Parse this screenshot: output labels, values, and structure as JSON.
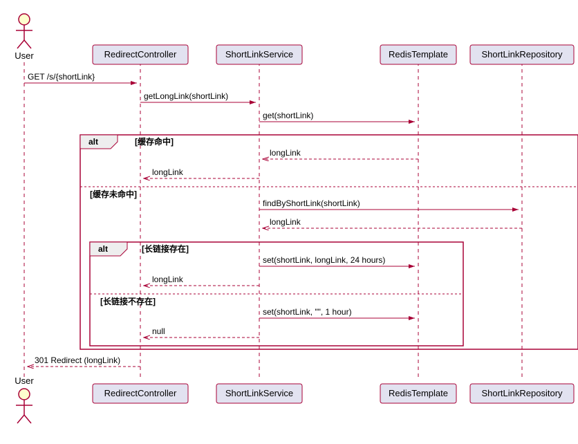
{
  "actor": {
    "name": "User"
  },
  "participants": {
    "p1": "RedirectController",
    "p2": "ShortLinkService",
    "p3": "RedisTemplate",
    "p4": "ShortLinkRepository"
  },
  "messages": {
    "m1": "GET /s/{shortLink}",
    "m2": "getLongLink(shortLink)",
    "m3": "get(shortLink)",
    "m4": "longLink",
    "m5": "longLink",
    "m6": "findByShortLink(shortLink)",
    "m7": "longLink",
    "m8": "set(shortLink, longLink, 24 hours)",
    "m9": "longLink",
    "m10": "set(shortLink, \"\", 1 hour)",
    "m11": "null",
    "m12": "301 Redirect (longLink)"
  },
  "alt": {
    "label": "alt",
    "cond1": "[缓存命中]",
    "cond2": "[缓存未命中]",
    "inner_cond1": "[长链接存在]",
    "inner_cond2": "[长链接不存在]"
  },
  "chart_data": {
    "type": "sequence_diagram",
    "actor": "User",
    "participants": [
      "RedirectController",
      "ShortLinkService",
      "RedisTemplate",
      "ShortLinkRepository"
    ],
    "interactions": [
      {
        "from": "User",
        "to": "RedirectController",
        "msg": "GET /s/{shortLink}",
        "type": "sync"
      },
      {
        "from": "RedirectController",
        "to": "ShortLinkService",
        "msg": "getLongLink(shortLink)",
        "type": "sync"
      },
      {
        "from": "ShortLinkService",
        "to": "RedisTemplate",
        "msg": "get(shortLink)",
        "type": "sync"
      },
      {
        "alt": "缓存命中",
        "steps": [
          {
            "from": "RedisTemplate",
            "to": "ShortLinkService",
            "msg": "longLink",
            "type": "return"
          },
          {
            "from": "ShortLinkService",
            "to": "RedirectController",
            "msg": "longLink",
            "type": "return"
          }
        ]
      },
      {
        "else": "缓存未命中",
        "steps": [
          {
            "from": "ShortLinkService",
            "to": "ShortLinkRepository",
            "msg": "findByShortLink(shortLink)",
            "type": "sync"
          },
          {
            "from": "ShortLinkRepository",
            "to": "ShortLinkService",
            "msg": "longLink",
            "type": "return"
          },
          {
            "alt": "长链接存在",
            "steps": [
              {
                "from": "ShortLinkService",
                "to": "RedisTemplate",
                "msg": "set(shortLink, longLink, 24 hours)",
                "type": "sync"
              },
              {
                "from": "ShortLinkService",
                "to": "RedirectController",
                "msg": "longLink",
                "type": "return"
              }
            ]
          },
          {
            "else": "长链接不存在",
            "steps": [
              {
                "from": "ShortLinkService",
                "to": "RedisTemplate",
                "msg": "set(shortLink, \"\", 1 hour)",
                "type": "sync"
              },
              {
                "from": "ShortLinkService",
                "to": "RedirectController",
                "msg": "null",
                "type": "return"
              }
            ]
          }
        ]
      },
      {
        "from": "RedirectController",
        "to": "User",
        "msg": "301 Redirect (longLink)",
        "type": "return"
      }
    ]
  }
}
